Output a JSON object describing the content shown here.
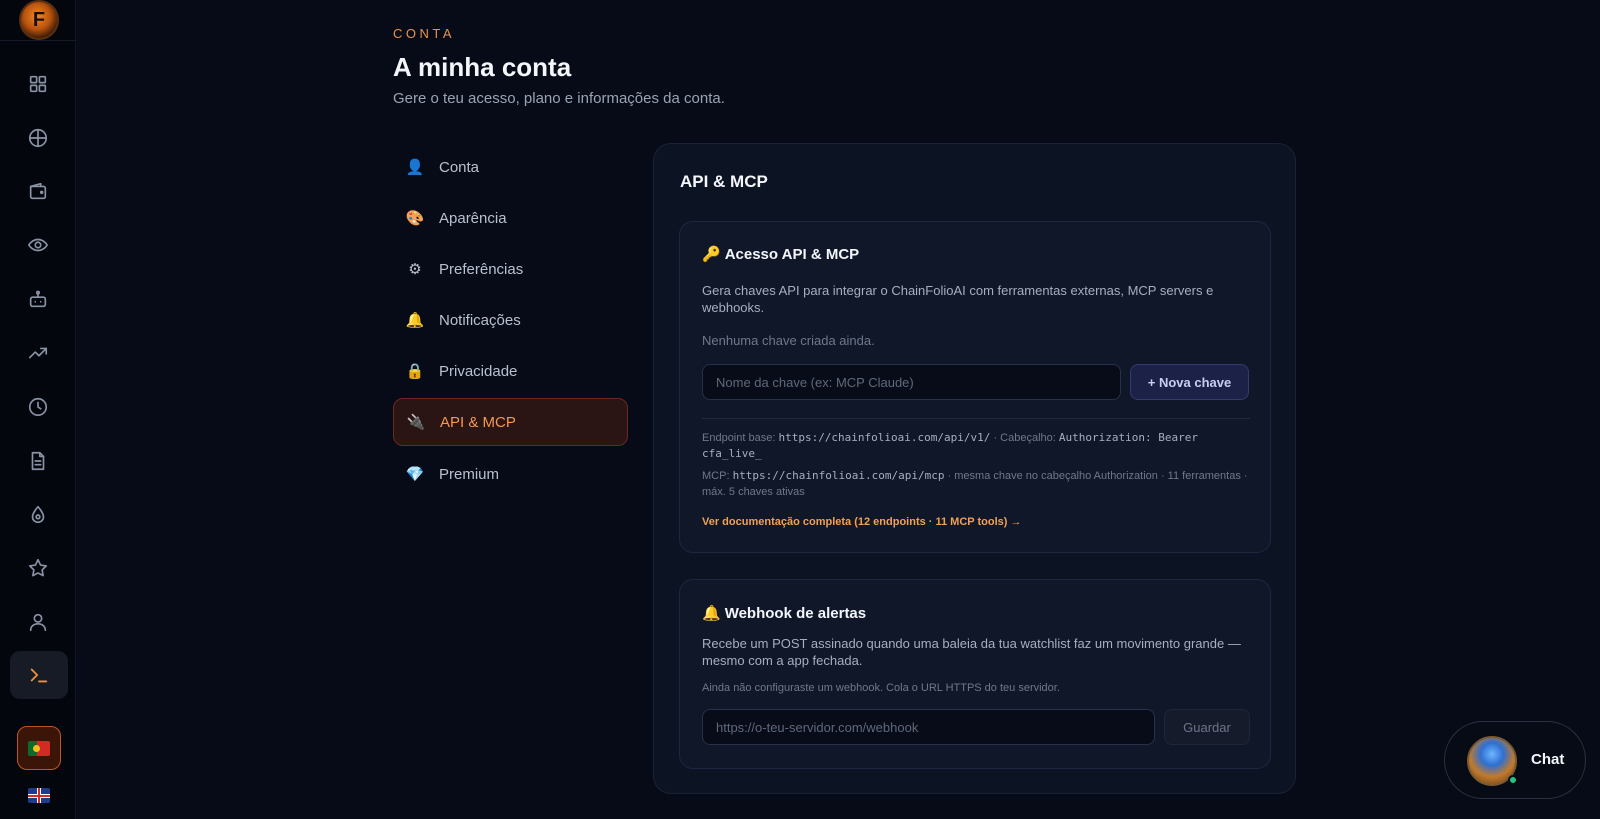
{
  "sidebar": {
    "logo_letter": "F",
    "icons": [
      "dashboard-icon",
      "globe-icon",
      "wallet-icon",
      "eye-icon",
      "bot-icon",
      "trending-icon",
      "clock-icon",
      "document-icon",
      "drop-icon",
      "star-icon",
      "user-icon",
      "terminal-icon"
    ],
    "languages": [
      "pt",
      "en"
    ]
  },
  "header": {
    "eyebrow": "CONTA",
    "title": "A minha conta",
    "subtitle": "Gere o teu acesso, plano e informações da conta."
  },
  "menu": {
    "items": [
      {
        "icon": "👤",
        "label": "Conta"
      },
      {
        "icon": "🎨",
        "label": "Aparência"
      },
      {
        "icon": "⚙",
        "label": "Preferências"
      },
      {
        "icon": "🔔",
        "label": "Notificações"
      },
      {
        "icon": "🔒",
        "label": "Privacidade"
      },
      {
        "icon": "🔌",
        "label": "API & MCP"
      },
      {
        "icon": "💎",
        "label": "Premium"
      }
    ],
    "active": "API & MCP"
  },
  "card": {
    "title": "API & MCP",
    "api_panel": {
      "emoji": "🔑",
      "title": "Acesso API & MCP",
      "description": "Gera chaves API para integrar o ChainFolioAI com ferramentas externas, MCP servers e webhooks.",
      "empty_text": "Nenhuma chave criada ainda.",
      "key_name_placeholder": "Nome da chave (ex: MCP Claude)",
      "new_key_button": "+ Nova chave",
      "endpoint_label": "Endpoint base:",
      "endpoint_url": "https://chainfolioai.com/api/v1/",
      "header_label": "· Cabeçalho:",
      "header_value": "Authorization: Bearer cfa_live_",
      "mcp_label": "MCP:",
      "mcp_url": "https://chainfolioai.com/api/mcp",
      "mcp_note": "· mesma chave no cabeçalho Authorization · 11 ferramentas · máx. 5 chaves ativas",
      "docs_link": "Ver documentação completa (12 endpoints · 11 MCP tools) →"
    },
    "webhook_panel": {
      "emoji": "🔔",
      "title": "Webhook de alertas",
      "description": "Recebe um POST assinado quando uma baleia da tua watchlist faz um movimento grande — mesmo com a app fechada.",
      "hint": "Ainda não configuraste um webhook. Cola o URL HTTPS do teu servidor.",
      "url_placeholder": "https://o-teu-servidor.com/webhook",
      "save_button": "Guardar"
    }
  },
  "chat": {
    "label": "Chat",
    "status": "online"
  },
  "colors": {
    "accent": "#f0913a",
    "background": "#060b17",
    "card": "#0c1322"
  }
}
